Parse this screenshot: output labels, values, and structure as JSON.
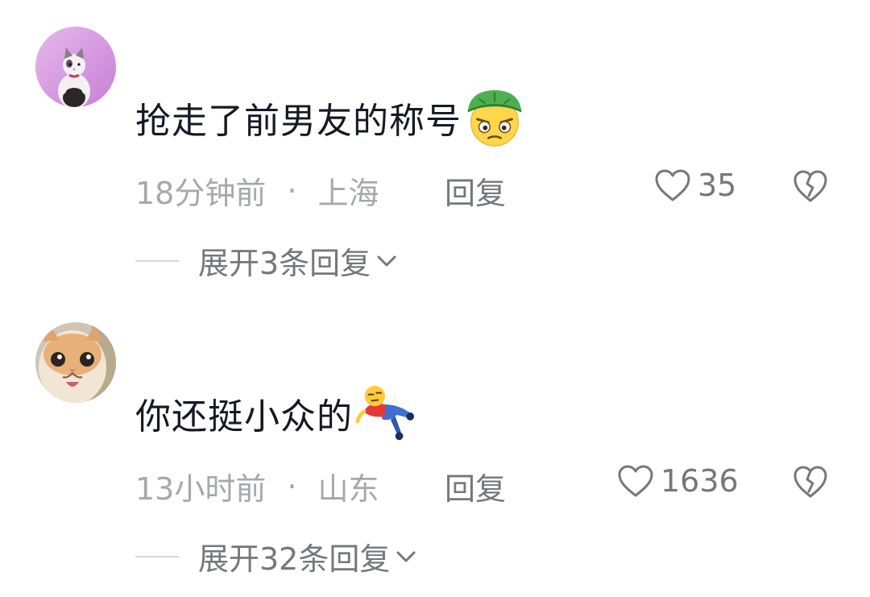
{
  "comments": [
    {
      "text": "抢走了前男友的称号",
      "emoji_icon": "green-hat-smirk-emoji",
      "time": "18分钟前",
      "separator": "·",
      "location": "上海",
      "reply_label": "回复",
      "likes": "35",
      "expand_label": "展开3条回复"
    },
    {
      "text": "你还挺小众的",
      "emoji_icon": "lying-down-person-emoji",
      "time": "13小时前",
      "separator": "·",
      "location": "山东",
      "reply_label": "回复",
      "likes": "1636",
      "expand_label": "展开32条回复"
    }
  ],
  "colors": {
    "text_primary": "#161823",
    "text_meta": "#a7a8ad",
    "text_secondary": "#75777d"
  }
}
